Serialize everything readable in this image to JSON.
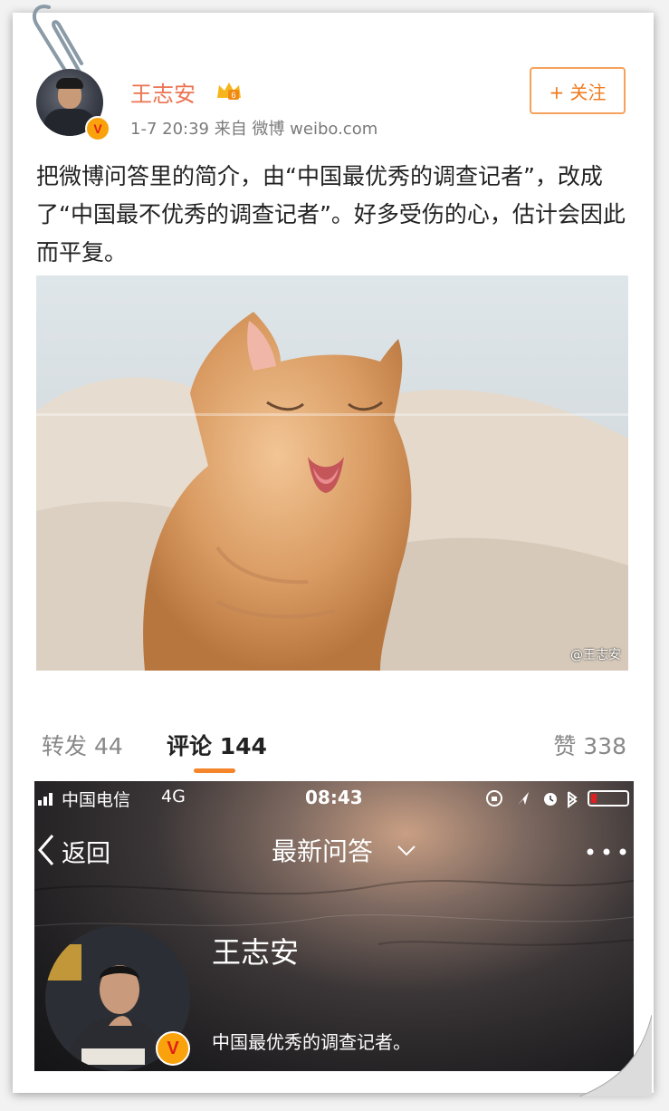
{
  "post": {
    "username": "王志安",
    "meta": "1-7 20:39  来自 微博 weibo.com",
    "follow_label": "+ 关注",
    "text": "把微博问答里的简介，由“中国最优秀的调查记者”，改成了“中国最不优秀的调查记者”。好多受伤的心，估计会因此而平复。",
    "image_watermark": "@王志安"
  },
  "tabs": {
    "repost": "转发 44",
    "comment": "评论 144",
    "like": "赞 338"
  },
  "screenshot": {
    "status": {
      "carrier": "中国电信",
      "network": "4G",
      "time": "08:43"
    },
    "nav": {
      "back_label": "返回",
      "title": "最新问答"
    },
    "profile": {
      "name": "王志安",
      "bio": "中国最优秀的调查记者。"
    }
  },
  "colors": {
    "username": "#eb7350",
    "follow_border": "#f5a25d",
    "tab_underline": "#f5852b",
    "verified_badge": "#f9a20b"
  }
}
